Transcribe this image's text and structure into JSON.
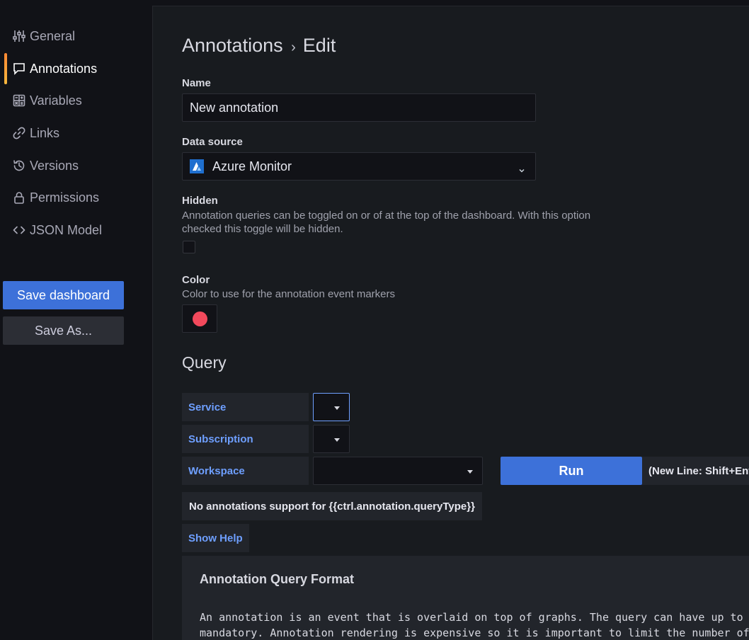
{
  "sidebar": {
    "items": [
      {
        "label": "General",
        "icon": "sliders-icon"
      },
      {
        "label": "Annotations",
        "icon": "comment-icon",
        "active": true
      },
      {
        "label": "Variables",
        "icon": "calculator-icon"
      },
      {
        "label": "Links",
        "icon": "link-icon"
      },
      {
        "label": "Versions",
        "icon": "history-icon"
      },
      {
        "label": "Permissions",
        "icon": "lock-icon"
      },
      {
        "label": "JSON Model",
        "icon": "code-icon"
      }
    ],
    "save_label": "Save dashboard",
    "save_as_label": "Save As..."
  },
  "header": {
    "title": "Annotations",
    "separator": "›",
    "subtitle": "Edit"
  },
  "form": {
    "name_label": "Name",
    "name_value": "New annotation",
    "datasource_label": "Data source",
    "datasource_value": "Azure Monitor",
    "hidden_label": "Hidden",
    "hidden_desc_line1": "Annotation queries can be toggled on or of at the top of the dashboard. With this option",
    "hidden_desc_line2": "checked this toggle will be hidden.",
    "hidden_checked": false,
    "color_label": "Color",
    "color_desc": "Color to use for the annotation event markers",
    "color_value": "#f2495c"
  },
  "query": {
    "section_title": "Query",
    "service_label": "Service",
    "subscription_label": "Subscription",
    "workspace_label": "Workspace",
    "run_label": "Run",
    "run_hint": "(New Line: Shift+Enter",
    "no_support_text": "No annotations support for {{ctrl.annotation.queryType}}",
    "show_help_label": "Show Help"
  },
  "help": {
    "title": "Annotation Query Format",
    "line1": "An annotation is an event that is overlaid on top of graphs. The query can have up to",
    "line2": "mandatory. Annotation rendering is expensive so it is important to limit the number of"
  },
  "colors": {
    "accent": "#3d71d9",
    "link_blue": "#6e9fff",
    "active_gradient_top": "#ff8833",
    "active_gradient_bottom": "#f5b73d",
    "annotation_color": "#f2495c"
  }
}
